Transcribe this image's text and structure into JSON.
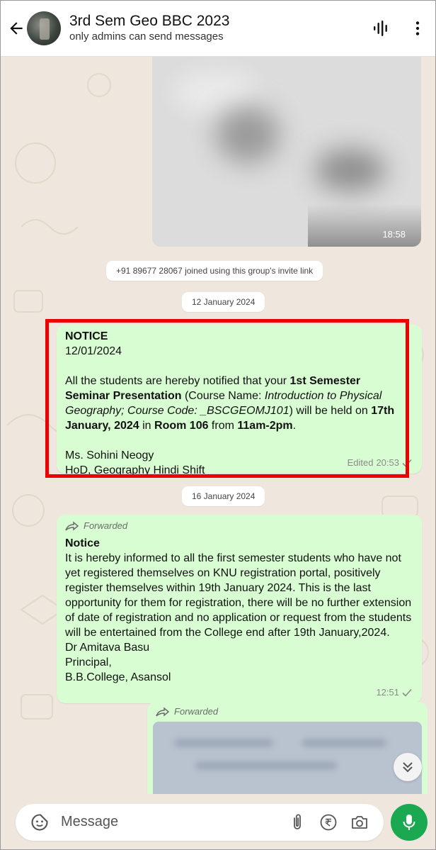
{
  "header": {
    "title": "3rd Sem Geo BBC 2023",
    "subtitle": "only admins can send messages"
  },
  "image_message": {
    "time": "18:58"
  },
  "system": {
    "joined": "+91 89677 28067 joined using this group's invite link",
    "date1": "12 January 2024",
    "date2": "16 January 2024"
  },
  "notice_msg": {
    "heading": "NOTICE",
    "date": "12/01/2024",
    "p_intro": "All the students are hereby notified that your ",
    "b_sem": "1st Semester Seminar Presentation",
    "p_course_open": " (Course Name: ",
    "i_course": "Introduction to Physical Geography; Course Code: _BSCGEOMJ101",
    "p_held": ") will be held on ",
    "b_date": "17th January, 2024",
    "p_in": " in ",
    "b_room": "Room 106",
    "p_from": " from ",
    "b_time": "11am-2pm",
    "p_end": ".",
    "sig_name": "Ms. Sohini Neogy",
    "sig_title": "HoD, Geography Hindi Shift",
    "edited_label": "Edited",
    "time": "20:53"
  },
  "forward_msg": {
    "forwarded_label": "Forwarded",
    "heading": "Notice",
    "body": "It is hereby informed to all the first semester students who have not yet registered themselves on KNU registration portal, positively register themselves within 19th January 2024. This is the last opportunity for them for registration, there will be no further extension of date of registration and no application or request from the students will be entertained from the College end after 19th January,2024.",
    "sig1": "Dr Amitava Basu",
    "sig2": "Principal,",
    "sig3": "B.B.College, Asansol",
    "time": "12:51"
  },
  "forward_img": {
    "forwarded_label": "Forwarded"
  },
  "input": {
    "placeholder": "Message",
    "value": ""
  },
  "colors": {
    "bubble": "#d9fdd3",
    "accent": "#1aa851",
    "highlight": "#ee0000"
  }
}
